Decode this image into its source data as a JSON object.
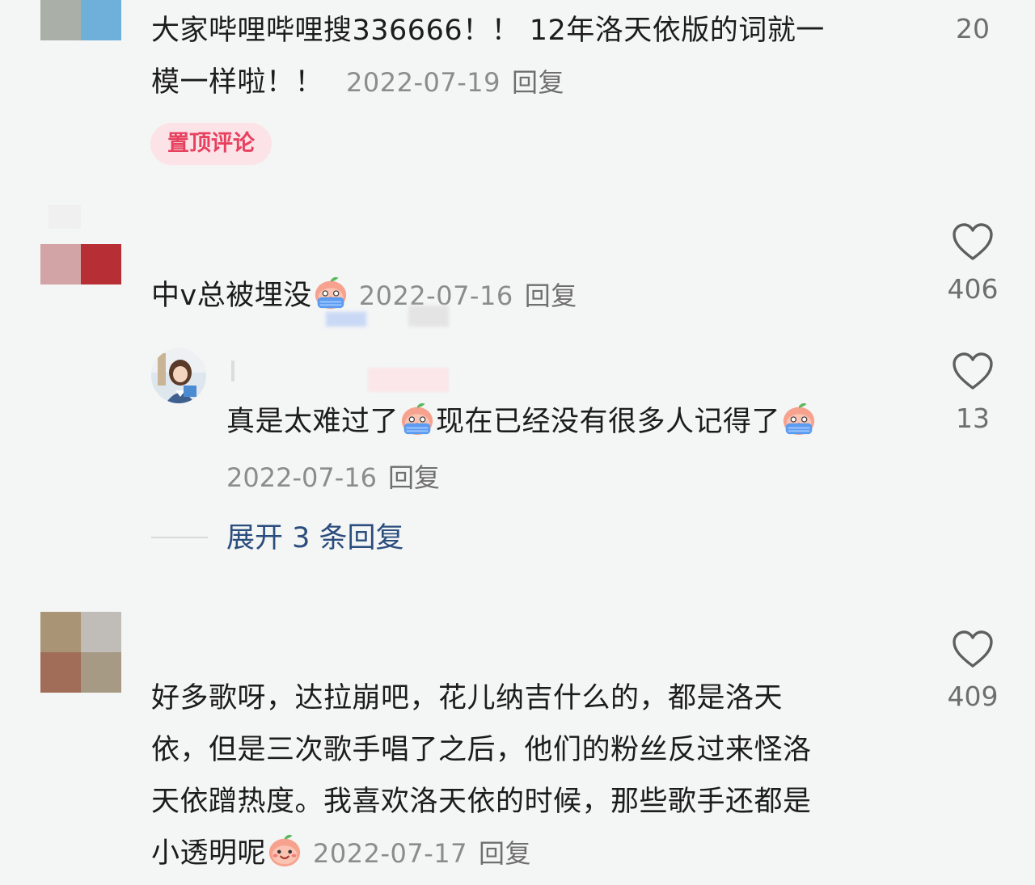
{
  "comments": [
    {
      "text_line1": "大家哔哩哔哩搜336666！！ 12年洛天依版的词就一",
      "text_line2": "模一样啦！！",
      "date": "2022-07-19",
      "reply": "回复",
      "badge": "置顶评论",
      "likes": "20"
    },
    {
      "text": "中v总被埋没",
      "date": "2022-07-16",
      "reply": "回复",
      "likes": "406",
      "sub_reply": {
        "text_a": "真是太难过了",
        "text_b": "现在已经没有很多人记得了",
        "date": "2022-07-16",
        "reply": "回复",
        "likes": "13"
      },
      "expand": "展开 3 条回复"
    },
    {
      "text_line1": "好多歌呀，达拉崩吧，花儿纳吉什么的，都是洛天",
      "text_line2": "依，但是三次歌手唱了之后，他们的粉丝反过来怪洛",
      "text_line3": "天依蹭热度。我喜欢洛天依的时候，那些歌手还都是",
      "text_line4": "小透明呢",
      "date": "2022-07-17",
      "reply": "回复",
      "likes": "409"
    }
  ],
  "icons": {
    "like": "heart-outline-icon",
    "crying": "crying-peach-emoji",
    "smile": "smiling-peach-emoji"
  },
  "colors": {
    "background": "#f4f5f5",
    "pin_badge_bg": "#fbe3e7",
    "pin_badge_text": "#e8415f",
    "expand_link": "#2b4d7e"
  }
}
